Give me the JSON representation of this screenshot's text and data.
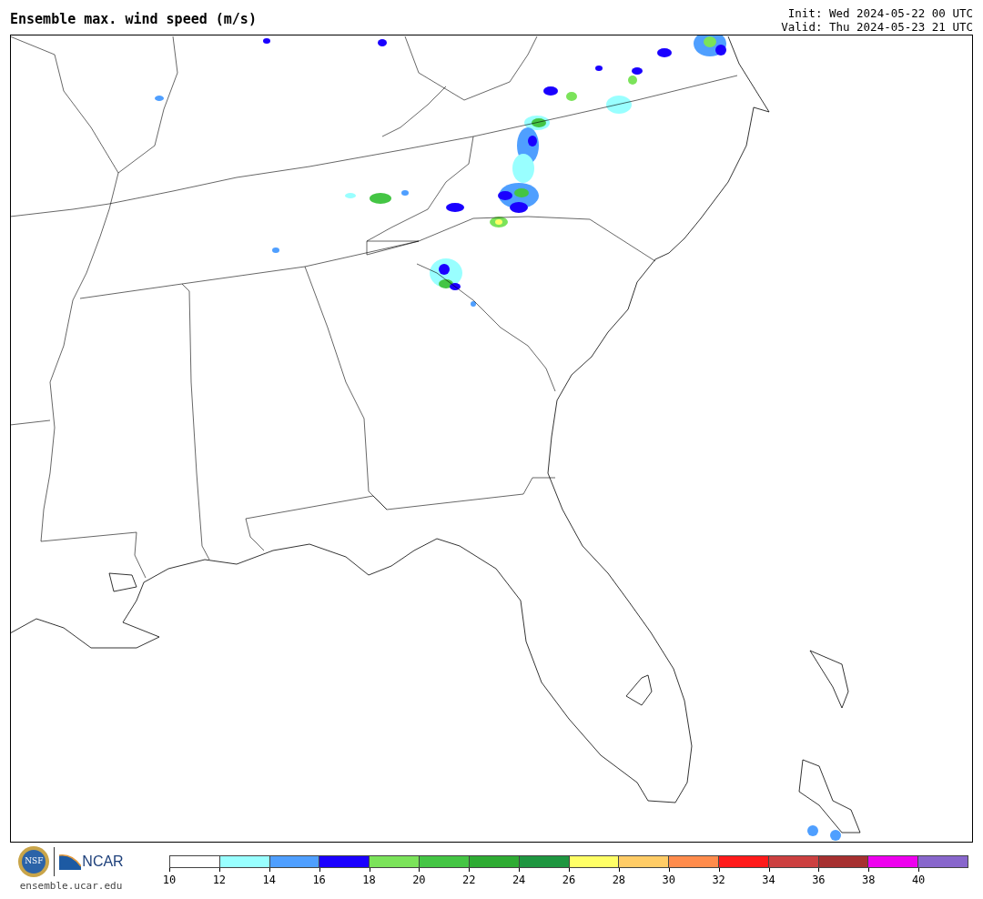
{
  "title": "Ensemble max. wind speed (m/s)",
  "init": "Init: Wed 2024-05-22 00 UTC",
  "valid": "Valid: Thu 2024-05-23 21 UTC",
  "logos": {
    "seal_text": "NSF",
    "org_text": "NCAR",
    "website": "ensemble.ucar.edu"
  },
  "colorbar": {
    "bins": [
      {
        "color": "#ffffff"
      },
      {
        "color": "#99ffff"
      },
      {
        "color": "#4f9fff"
      },
      {
        "color": "#1a00ff"
      },
      {
        "color": "#7be35a"
      },
      {
        "color": "#44c544"
      },
      {
        "color": "#2eab33"
      },
      {
        "color": "#1e9640"
      },
      {
        "color": "#ffff66"
      },
      {
        "color": "#ffcc66"
      },
      {
        "color": "#ff8c4c"
      },
      {
        "color": "#ff1a1a"
      },
      {
        "color": "#cc4040"
      },
      {
        "color": "#a63030"
      },
      {
        "color": "#ee00ee"
      },
      {
        "color": "#8866cc"
      }
    ],
    "ticks": [
      "10",
      "12",
      "14",
      "16",
      "18",
      "20",
      "22",
      "24",
      "26",
      "28",
      "30",
      "32",
      "34",
      "36",
      "38",
      "40"
    ]
  }
}
